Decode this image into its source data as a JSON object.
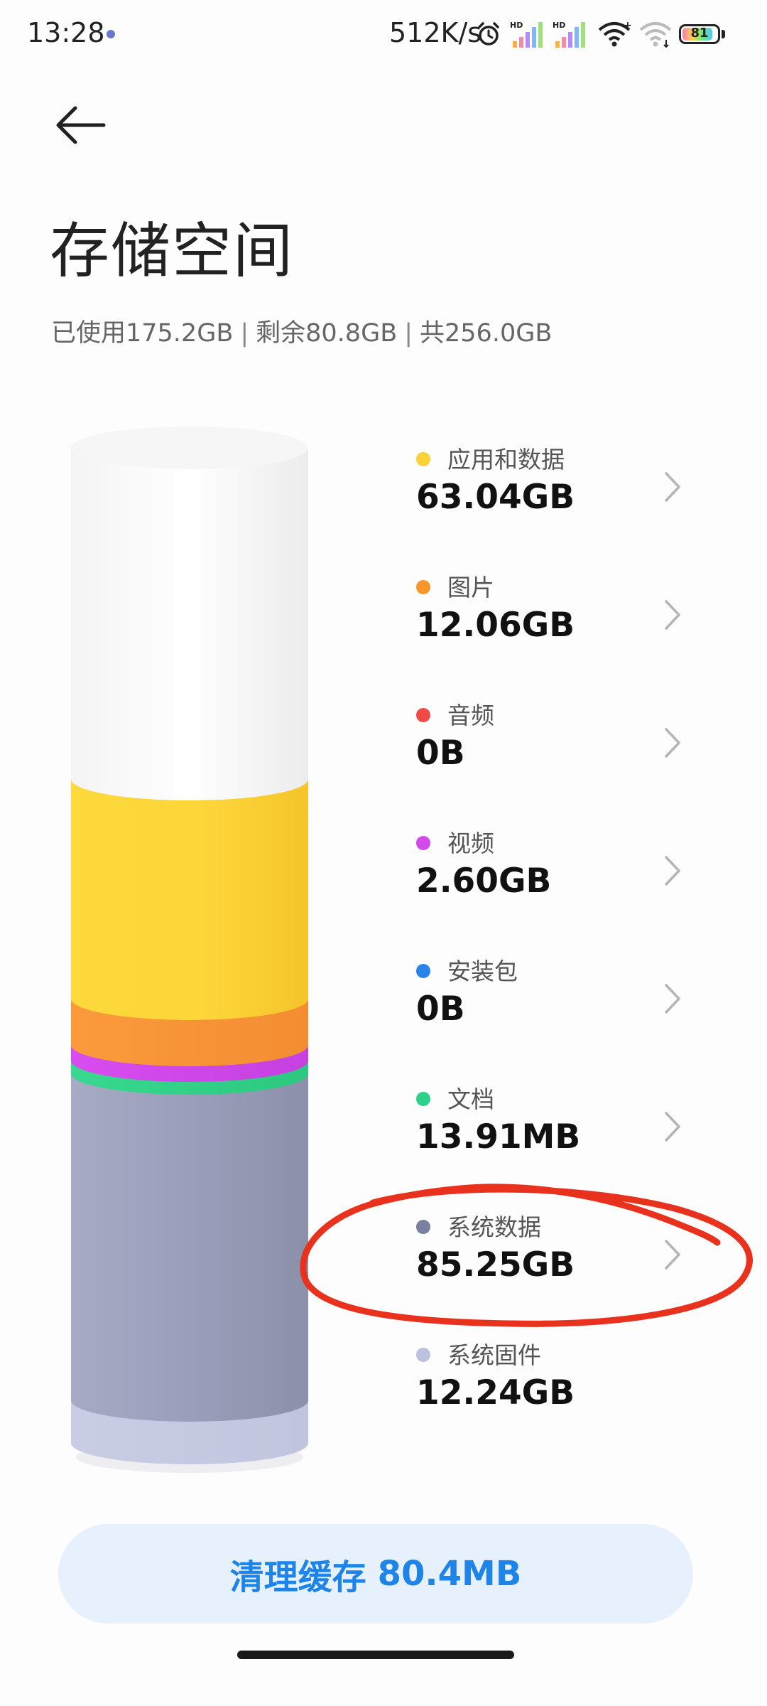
{
  "status_bar": {
    "time": "13:28",
    "net_speed": "512K/s",
    "signal_1_label": "HD",
    "signal_2_label": "HD",
    "battery_level": "81",
    "icons": [
      "alarm-icon",
      "signal-icon",
      "signal-icon",
      "wifi-icon",
      "wifi-icon",
      "battery-icon"
    ]
  },
  "header": {
    "back_icon": "arrow-left-icon",
    "title": "存储空间"
  },
  "summary": {
    "used": "已使用175.2GB",
    "remaining": "剩余80.8GB",
    "total": "共256.0GB",
    "separator": "|"
  },
  "categories": [
    {
      "label": "应用和数据",
      "value": "63.04GB",
      "color": "#fcd23a",
      "has_chevron": true
    },
    {
      "label": "图片",
      "value": "12.06GB",
      "color": "#f7962b",
      "has_chevron": true
    },
    {
      "label": "音频",
      "value": "0B",
      "color": "#ef4b46",
      "has_chevron": true
    },
    {
      "label": "视频",
      "value": "2.60GB",
      "color": "#d24ae8",
      "has_chevron": true
    },
    {
      "label": "安装包",
      "value": "0B",
      "color": "#2a83e8",
      "has_chevron": true
    },
    {
      "label": "文档",
      "value": "13.91MB",
      "color": "#2fd18a",
      "has_chevron": true
    },
    {
      "label": "系统数据",
      "value": "85.25GB",
      "color": "#7c80a0",
      "has_chevron": true
    },
    {
      "label": "系统固件",
      "value": "12.24GB",
      "color": "#bcc1de",
      "has_chevron": false
    }
  ],
  "clean_button": {
    "label": "清理缓存",
    "size": "80.4MB",
    "color": "#1e84e8"
  },
  "colors": {
    "accent": "#1e84e8",
    "annotation": "#e8321e"
  }
}
